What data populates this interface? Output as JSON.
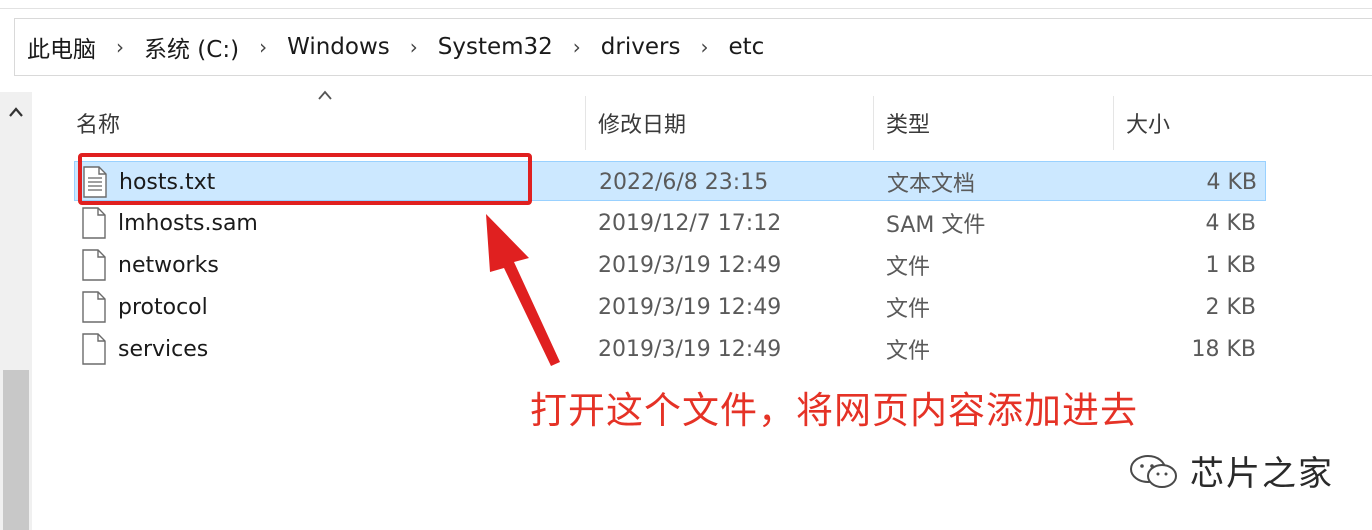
{
  "breadcrumb": [
    "此电脑",
    "系统 (C:)",
    "Windows",
    "System32",
    "drivers",
    "etc"
  ],
  "columns": {
    "name": "名称",
    "modified": "修改日期",
    "type": "类型",
    "size": "大小"
  },
  "files": [
    {
      "name": "hosts.txt",
      "modified": "2022/6/8 23:15",
      "type": "文本文档",
      "size": "4 KB",
      "icon": "text-file-icon"
    },
    {
      "name": "lmhosts.sam",
      "modified": "2019/12/7 17:12",
      "type": "SAM 文件",
      "size": "4 KB",
      "icon": "file-icon"
    },
    {
      "name": "networks",
      "modified": "2019/3/19 12:49",
      "type": "文件",
      "size": "1 KB",
      "icon": "file-icon"
    },
    {
      "name": "protocol",
      "modified": "2019/3/19 12:49",
      "type": "文件",
      "size": "2 KB",
      "icon": "file-icon"
    },
    {
      "name": "services",
      "modified": "2019/3/19 12:49",
      "type": "文件",
      "size": "18 KB",
      "icon": "file-icon"
    }
  ],
  "annotation": "打开这个文件，将网页内容添加进去",
  "watermark": "芯片之家",
  "colors": {
    "highlight": "#e02020",
    "annotation": "#e53226",
    "selection": "#cce8ff"
  }
}
